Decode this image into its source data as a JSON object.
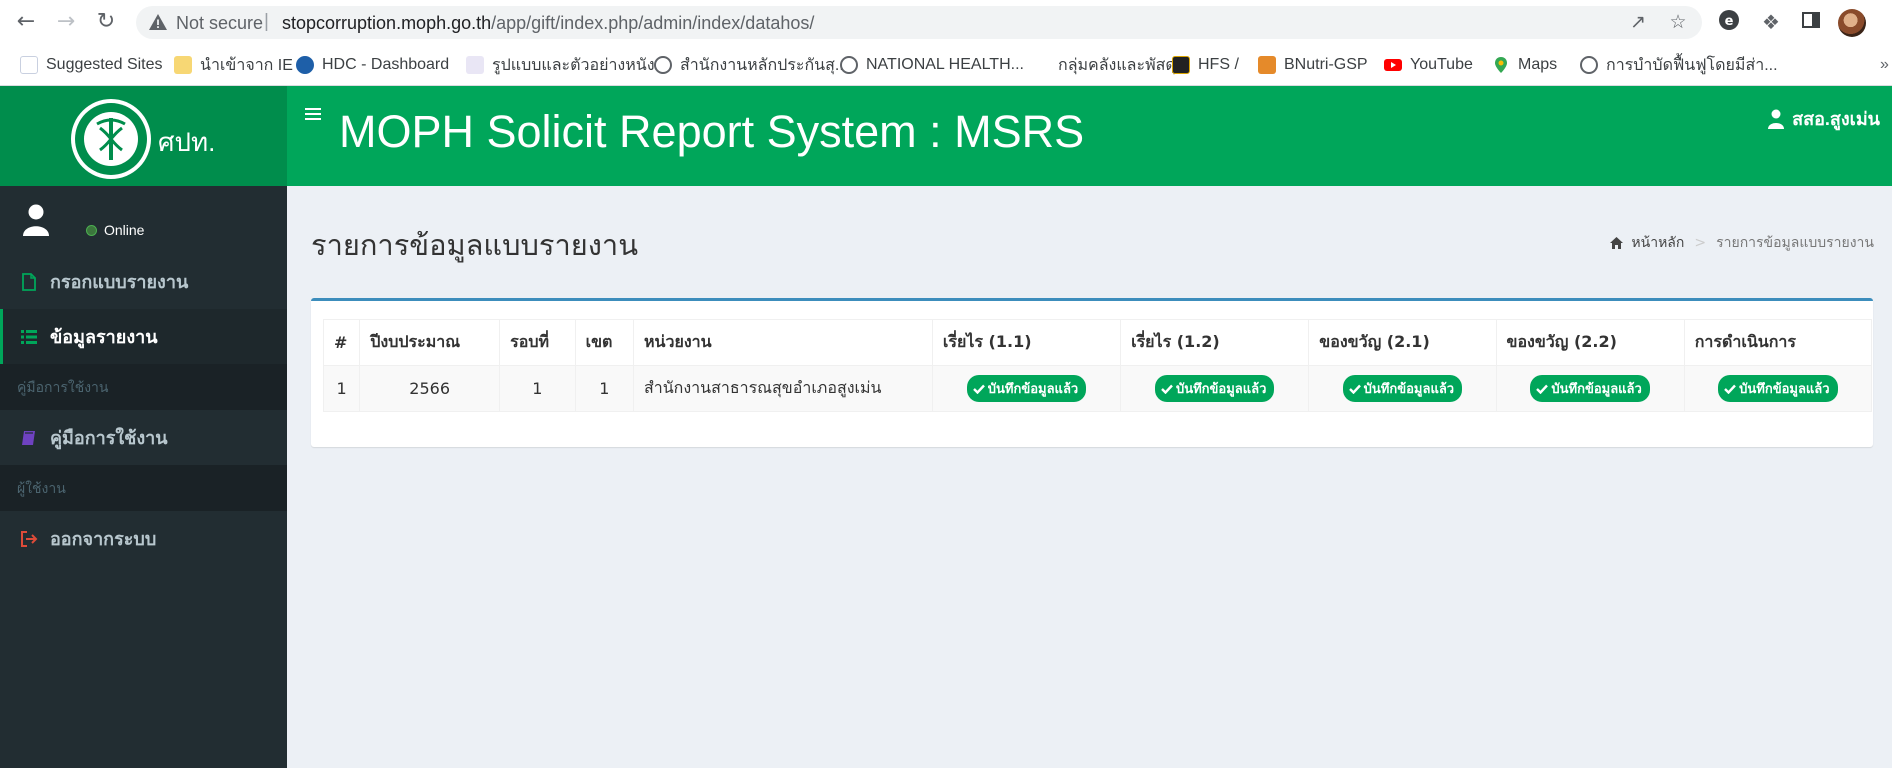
{
  "browser": {
    "not_secure": "Not secure",
    "url_host": "stopcorruption.moph.go.th",
    "url_path": "/app/gift/index.php/admin/index/datahos/",
    "bookmarks": [
      "Suggested Sites",
      "นำเข้าจาก IE",
      "HDC - Dashboard",
      "รูปแบบและตัวอย่างหนัง...",
      "สำนักงานหลักประกันสุ...",
      "NATIONAL HEALTH...",
      "กลุ่มคลังและพัสดุ",
      "HFS /",
      "BNutri-GSP",
      "YouTube",
      "Maps",
      "การบำบัดฟื้นฟูโดยมีส่า..."
    ],
    "bookmarks_more": "»"
  },
  "header": {
    "logo_text": "ศปท.",
    "title": "MOPH Solicit Report System : MSRS",
    "user": "สสอ.สูงเม่น"
  },
  "sidebar": {
    "status": "Online",
    "items": [
      {
        "label": "กรอกแบบรายงาน",
        "icon": "file-icon"
      },
      {
        "label": "ข้อมูลรายงาน",
        "icon": "list-icon"
      },
      {
        "header": "คู่มือการใช้งาน"
      },
      {
        "label": "คู่มือการใช้งาน",
        "icon": "book-icon"
      },
      {
        "header": "ผู้ใช้งาน"
      },
      {
        "label": "ออกจากระบบ",
        "icon": "sign-out-icon"
      }
    ]
  },
  "content": {
    "title": "รายการข้อมูลแบบรายงาน",
    "breadcrumb": {
      "home": "หน้าหลัก",
      "current": "รายการข้อมูลแบบรายงาน"
    }
  },
  "table": {
    "headers": [
      "#",
      "ปีงบประมาณ",
      "รอบที่",
      "เขต",
      "หน่วยงาน",
      "เรี่ยไร (1.1)",
      "เรี่ยไร (1.2)",
      "ของขวัญ (2.1)",
      "ของขวัญ (2.2)",
      "การดำเนินการ"
    ],
    "rows": [
      {
        "no": "1",
        "year": "2566",
        "round": "1",
        "zone": "1",
        "unit": "สำนักงานสาธารณสุขอำเภอสูงเม่น",
        "s11": "บันทึกข้อมูลแล้ว",
        "s12": "บันทึกข้อมูลแล้ว",
        "s21": "บันทึกข้อมูลแล้ว",
        "s22": "บันทึกข้อมูลแล้ว",
        "action": "บันทึกข้อมูลแล้ว"
      }
    ]
  },
  "colors": {
    "header_green": "#00a65a",
    "logo_green": "#008d4c",
    "sidebar_bg": "#222d32",
    "box_border": "#3c8dbc"
  }
}
